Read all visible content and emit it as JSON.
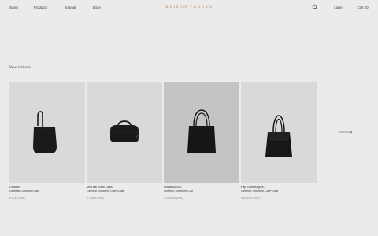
{
  "header": {
    "nav": [
      "Brand",
      "Products",
      "Journal",
      "Store"
    ],
    "logo": "MAISON TAKUYA",
    "login": "Login",
    "cart_label": "Cart",
    "cart_count": "(0)"
  },
  "section": {
    "title": "New arrivals"
  },
  "products": [
    {
      "name": "Ondared",
      "material": "German Chromhh Calf",
      "price": "¥ 2,000 (Inlv.)"
    },
    {
      "name": "Mini Bai Brfafl Case2",
      "material": "German Shromhn Calf+Goat",
      "price": "¥ 1,6800 (Inlv.)"
    },
    {
      "name": "Ura BRAMSO",
      "material": "German Shromhn Calf",
      "price": "¥ 46,0000 (Inlv.)"
    },
    {
      "name": "Papi Brief Bagd/s.1",
      "material": "German Shromhn Calf+Goat",
      "price": "¥ 61,5000 (Inlv.)"
    }
  ],
  "colors": {
    "background": "#ebebeb",
    "logo": "#b98a55",
    "card_bg": "#d9d9d9",
    "card_bg_dark": "#c4c4c4"
  },
  "icons": {
    "search": "search-icon",
    "next": "arrow-right-icon"
  }
}
